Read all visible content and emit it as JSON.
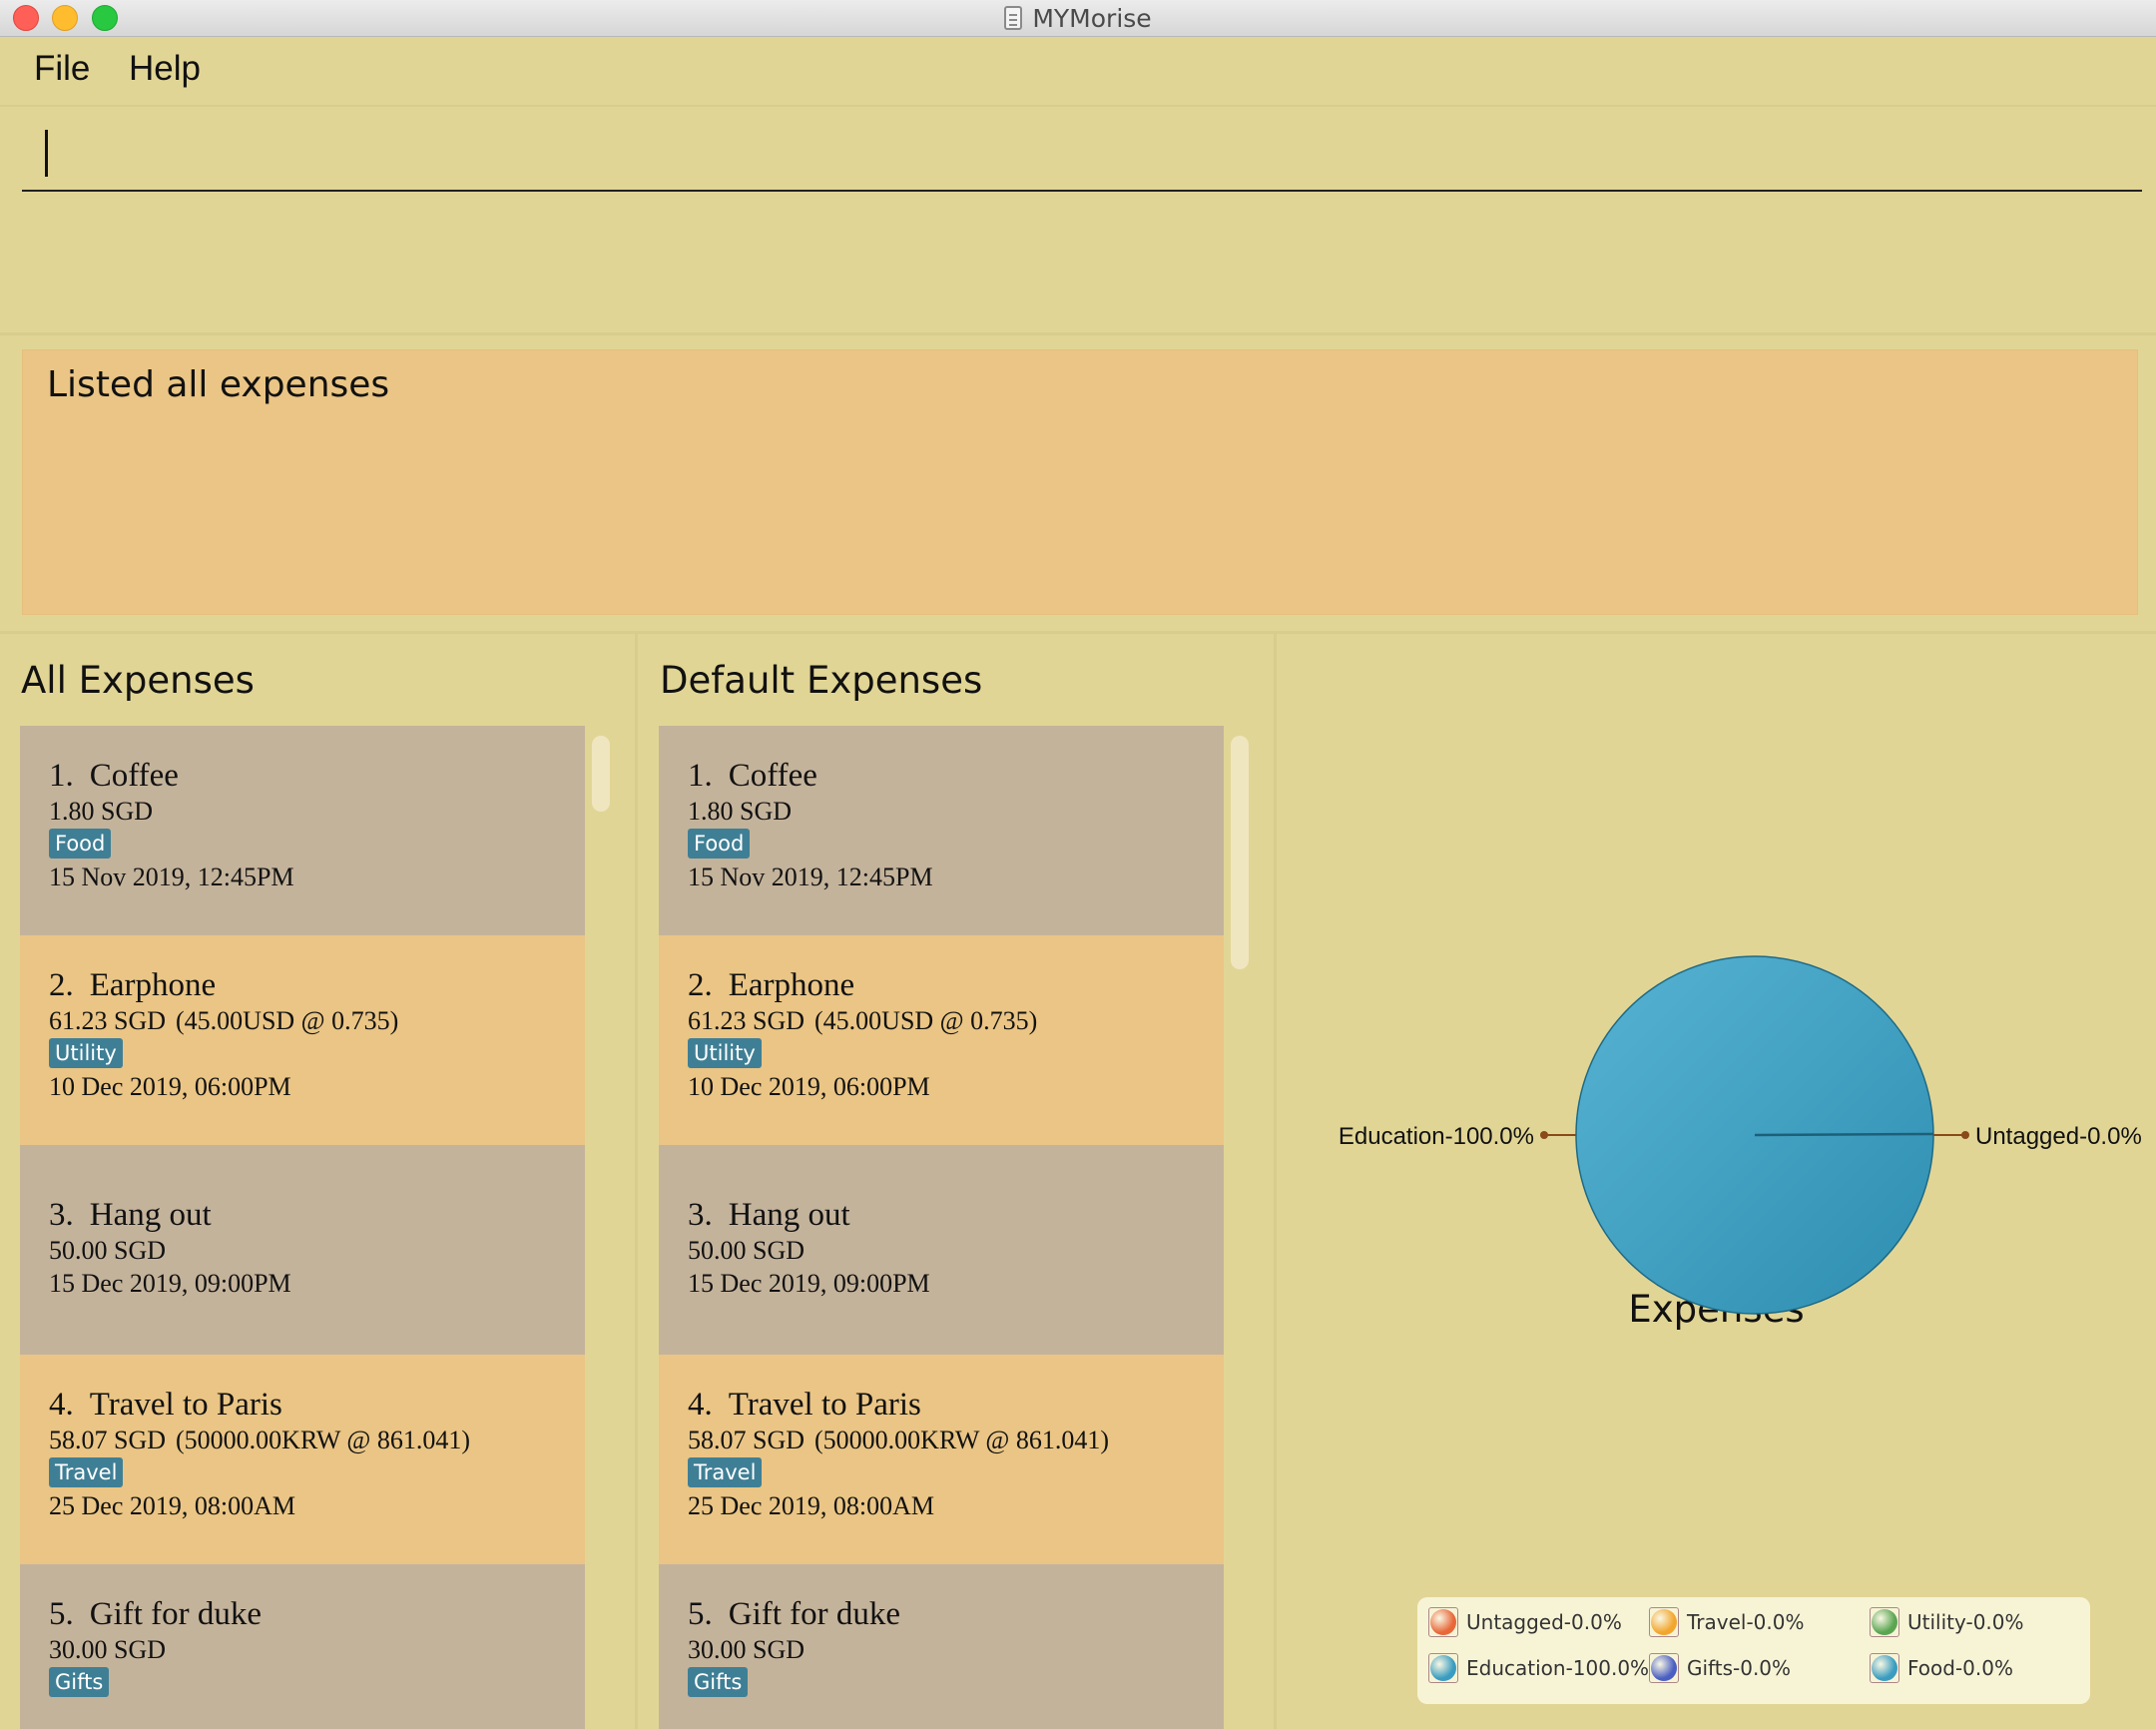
{
  "window": {
    "title": "MYMorise"
  },
  "menu": {
    "file": "File",
    "help": "Help"
  },
  "command": {
    "value": ""
  },
  "result": {
    "message": "Listed all expenses"
  },
  "panels": {
    "all_title": "All Expenses",
    "default_title": "Default Expenses",
    "chart_title": "Expenses"
  },
  "expenses": [
    {
      "index": "1.",
      "name": "Coffee",
      "amount": "1.80 SGD",
      "conversion": "",
      "tag": "Food",
      "date": "15 Nov 2019, 12:45PM"
    },
    {
      "index": "2.",
      "name": "Earphone",
      "amount": "61.23 SGD",
      "conversion": "(45.00USD @ 0.735)",
      "tag": "Utility",
      "date": "10 Dec 2019, 06:00PM"
    },
    {
      "index": "3.",
      "name": "Hang out",
      "amount": "50.00 SGD",
      "conversion": "",
      "tag": "",
      "date": "15 Dec 2019, 09:00PM"
    },
    {
      "index": "4.",
      "name": "Travel to Paris",
      "amount": "58.07 SGD",
      "conversion": "(50000.00KRW @ 861.041)",
      "tag": "Travel",
      "date": "25 Dec 2019, 08:00AM"
    },
    {
      "index": "5.",
      "name": "Gift for duke",
      "amount": "30.00 SGD",
      "conversion": "",
      "tag": "Gifts",
      "date": ""
    }
  ],
  "colors": {
    "odd_card": "#c4b39b",
    "even_card": "#eac585",
    "tag": "#3f7f95",
    "background": "#e1d595"
  },
  "chart_data": {
    "type": "pie",
    "title": "Expenses",
    "slices": [
      {
        "label": "Untagged",
        "value": 0.0,
        "display": "Untagged-0.0%",
        "color": "#e8683a"
      },
      {
        "label": "Travel",
        "value": 0.0,
        "display": "Travel-0.0%",
        "color": "#f2a62e"
      },
      {
        "label": "Utility",
        "value": 0.0,
        "display": "Utility-0.0%",
        "color": "#5aa552"
      },
      {
        "label": "Education",
        "value": 100.0,
        "display": "Education-100.0%",
        "color": "#3a9cc0"
      },
      {
        "label": "Gifts",
        "value": 0.0,
        "display": "Gifts-0.0%",
        "color": "#4a5fc2"
      },
      {
        "label": "Food",
        "value": 0.0,
        "display": "Food-0.0%",
        "color": "#3a9cc0"
      }
    ],
    "pie_labels": [
      "Education-100.0%",
      "Untagged-0.0%"
    ],
    "legend_position": "bottom"
  }
}
